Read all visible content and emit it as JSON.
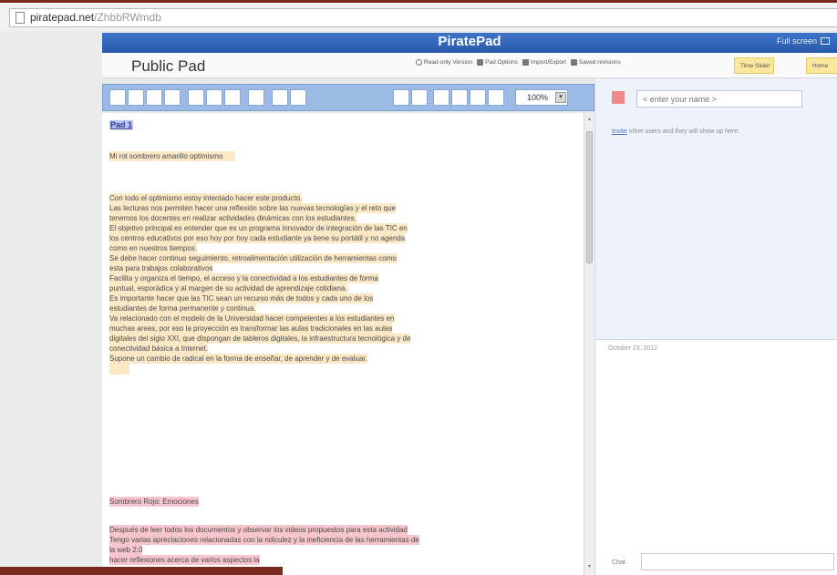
{
  "browser": {
    "url_domain": "piratepad.net",
    "url_path": "/ZhbbRWmdb"
  },
  "header": {
    "title": "PiratePad",
    "full_screen": "Full screen"
  },
  "docbar": {
    "pad_name": "Public Pad",
    "links": [
      "Read-only Version",
      "Pad Options",
      "Import/Export",
      "Saved revisions"
    ],
    "time_slider": "Time Slider",
    "home": "Home"
  },
  "toolbar": {
    "zoom": "100%"
  },
  "editor": {
    "pad_heading": "Pad 1",
    "lines_yellow_intro": "Mi rol sombrero amarillo    optimismo",
    "lines_yellow": [
      "    Con todo el optimismo estoy intentado hacer este producto.",
      "    Las lecturas nos permiten hacer una reflexión sobre las nuevas tecnologías y el reto que",
      "tenemos los docentes en  realizar actividades dinámicas con los estudiantes.",
      "    El objetivo principal es entender que es un programa innovador de integración de las TIC en",
      "los centros educativos por eso hoy por hoy cada estudiante ya tiene su portátil y no agenda",
      "como en nuestros tiempos.",
      "        Se debe hacer  continuo seguimiento, retroalimentación utilización de herramientas como",
      "esta  para trabajos colaborativos",
      "          Facilita y  organiza el tiempo,  el acceso y la conectividad a los estudiantes de forma",
      "puntual, esporádica y al margen de su actividad de aprendizaje cotidiana.",
      "          Es importante  hacer que las TIC sean un recurso más de todos y cada uno de los",
      "estudiantes  de forma permanente  y continua.",
      "          Va relacionado con el modelo de la Universidad hacer competentes a los estudiantes en",
      "muchas areas, por eso  la proyección es  transformar las aulas tradicionales en  las  aulas",
      "digitales del siglo XXI, que dispongan de tableros digitales, la infraestructura tecnológica y de",
      "conectividad básica a Internet.",
      "          Supone un cambio de radical en la forma de enseñar, de aprender y de evaluar."
    ],
    "pink_heading": "Sombrero Rojo: Emociones",
    "lines_pink": [
      "Después de leer todos los documentos y observar los videos propuestos para esta actividad",
      "Tengo varias apreciaciones relacionadas con la ridiculez y la ineficiencia de las herramientas de",
      "la web 2.0",
      "                                        hacer reflexiones acerca de varios aspectos la"
    ]
  },
  "users": {
    "name_placeholder": "< enter your name >",
    "invite_link": "Invite",
    "invite_rest": " other users and they will show up here."
  },
  "chat": {
    "date": "October 23, 2012",
    "label": "Chat"
  },
  "colors": {
    "header_blue": "#2f62b4",
    "highlight_yellow": "#fbe8c6",
    "highlight_pink": "#f6c6cc",
    "user_color": "#f08a8a"
  }
}
